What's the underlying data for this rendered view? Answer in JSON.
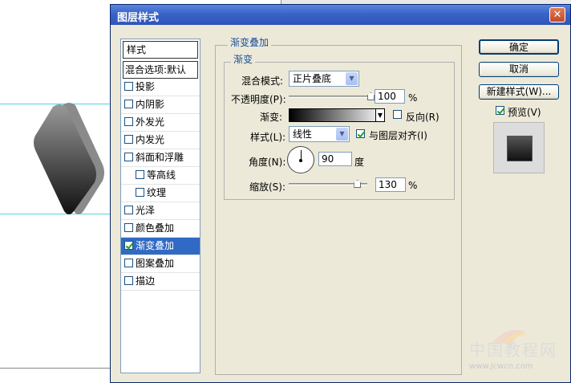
{
  "dialog": {
    "title": "图层样式",
    "close_glyph": "✕"
  },
  "style_list": {
    "header": "样式",
    "blend_options": "混合选项:默认",
    "items": [
      {
        "label": "投影",
        "checked": false,
        "indent": false,
        "selected": false
      },
      {
        "label": "内阴影",
        "checked": false,
        "indent": false,
        "selected": false
      },
      {
        "label": "外发光",
        "checked": false,
        "indent": false,
        "selected": false
      },
      {
        "label": "内发光",
        "checked": false,
        "indent": false,
        "selected": false
      },
      {
        "label": "斜面和浮雕",
        "checked": false,
        "indent": false,
        "selected": false
      },
      {
        "label": "等高线",
        "checked": false,
        "indent": true,
        "selected": false
      },
      {
        "label": "纹理",
        "checked": false,
        "indent": true,
        "selected": false
      },
      {
        "label": "光泽",
        "checked": false,
        "indent": false,
        "selected": false
      },
      {
        "label": "颜色叠加",
        "checked": false,
        "indent": false,
        "selected": false
      },
      {
        "label": "渐变叠加",
        "checked": true,
        "indent": false,
        "selected": true
      },
      {
        "label": "图案叠加",
        "checked": false,
        "indent": false,
        "selected": false
      },
      {
        "label": "描边",
        "checked": false,
        "indent": false,
        "selected": false
      }
    ]
  },
  "gradient_overlay": {
    "group_title": "渐变叠加",
    "inner_title": "渐变",
    "blend_mode_label": "混合模式:",
    "blend_mode_value": "正片叠底",
    "opacity_label": "不透明度(P):",
    "opacity_value": "100",
    "opacity_fraction": 1.0,
    "percent": "%",
    "gradient_label": "渐变:",
    "reverse_label": "反向(R)",
    "reverse_checked": false,
    "style_label": "样式(L):",
    "style_value": "线性",
    "align_label": "与图层对齐(I)",
    "align_checked": true,
    "angle_label": "角度(N):",
    "angle_value": "90",
    "angle_unit": "度",
    "scale_label": "缩放(S):",
    "scale_value": "130",
    "scale_fraction": 0.87
  },
  "buttons": {
    "ok": "确定",
    "cancel": "取消",
    "new_style": "新建样式(W)...",
    "preview": "预览(V)",
    "preview_checked": true
  },
  "watermark": {
    "text": "中国教程网",
    "url": "www.jcwcn.com"
  },
  "icons": {
    "close": "close-icon",
    "dropdown": "chevron-down-icon",
    "angle": "angle-dial-icon"
  }
}
